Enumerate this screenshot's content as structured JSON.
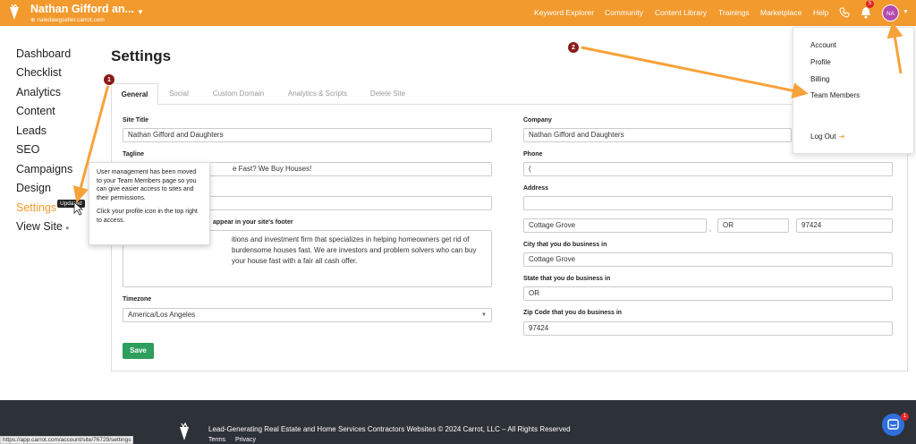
{
  "header": {
    "site_name": "Nathan Gifford an...",
    "site_url": "naledawgseller.carrot.com",
    "nav": [
      "Keyword Explorer",
      "Community",
      "Content Library",
      "Trainings",
      "Marketplace",
      "Help"
    ],
    "notification_count": "5",
    "avatar_initials": "NA"
  },
  "sidebar": {
    "items": [
      "Dashboard",
      "Checklist",
      "Analytics",
      "Content",
      "Leads",
      "SEO",
      "Campaigns",
      "Design",
      "Settings",
      "View Site"
    ],
    "active": "Settings"
  },
  "page": {
    "title": "Settings",
    "tabs": [
      "General",
      "Social",
      "Custom Domain",
      "Analytics & Scripts",
      "Delete Site"
    ]
  },
  "form": {
    "site_title_label": "Site Title",
    "site_title_value": "Nathan Gifford and Daughters",
    "tagline_label": "Tagline",
    "tagline_value": "e Fast? We Buy Houses!",
    "footer_label": "appear in your site's footer",
    "footer_text": "itions and investment firm that specializes in helping homeowners get rid of burdensome houses fast. We are investors and problem solvers who can buy your house fast with a fair all cash offer.",
    "timezone_label": "Timezone",
    "timezone_value": "America/Los Angeles",
    "company_label": "Company",
    "company_value": "Nathan Gifford and Daughters",
    "phone_label": "Phone",
    "phone_value": "(",
    "address_label": "Address",
    "address_value": "",
    "city_value": "Cottage Grove",
    "state_value": "OR",
    "zip_value": "97424",
    "business_city_label": "City that you do business in",
    "business_city_value": "Cottage Grove",
    "business_state_label": "State that you do business in",
    "business_state_value": "OR",
    "business_zip_label": "Zip Code that you do business in",
    "business_zip_value": "97424",
    "save_label": "Save"
  },
  "dropdown": {
    "items": [
      "Account",
      "Profile",
      "Billing",
      "Team Members"
    ],
    "logout": "Log Out"
  },
  "tooltip": {
    "p1": "User management has been moved to your Team Members page so you can give easier access to sites and their permissions.",
    "p2": "Click your profile icon in the top right to access.",
    "badge": "Updated"
  },
  "annotations": {
    "step1": "1",
    "step2": "2",
    "arrow_color": "#f7a23a"
  },
  "footer": {
    "copyright": "Lead-Generating Real Estate and Home Services Contractors Websites © 2024 Carrot, LLC – All Rights Reserved",
    "links": [
      "Terms",
      "Privacy"
    ],
    "status_url": "https://app.carrot.com/account/site/76729/settings",
    "chat_badge": "1"
  },
  "colors": {
    "brand_orange": "#f29a2e",
    "save_green": "#2e9e5c",
    "footer_bg": "#2d3138"
  }
}
